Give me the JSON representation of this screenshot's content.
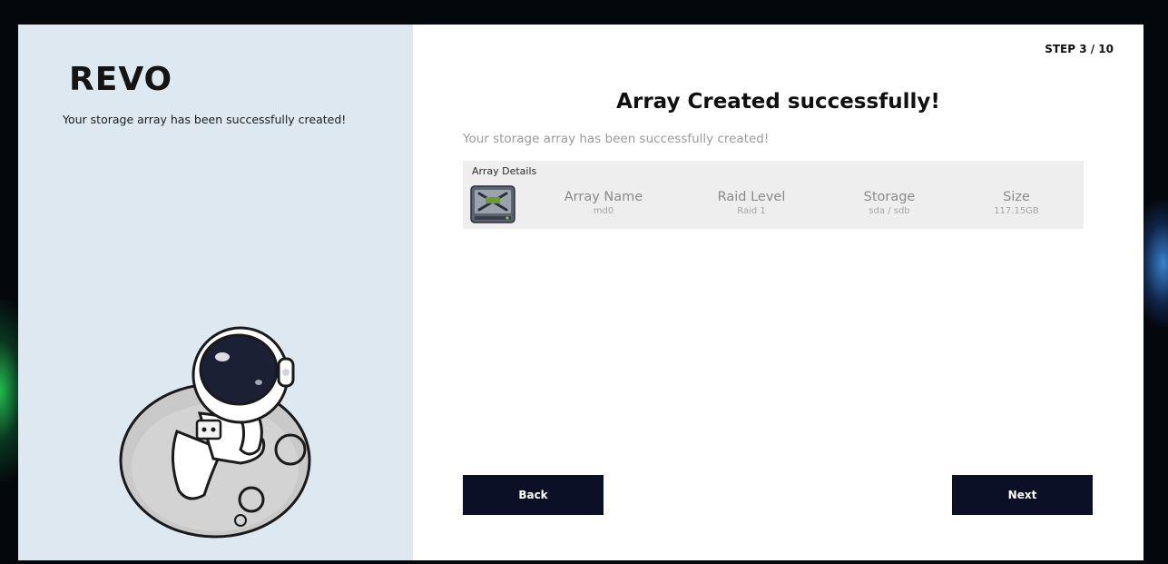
{
  "app": {
    "logo": "REVO"
  },
  "sidebar": {
    "description": "Your storage array has been successfully created!"
  },
  "header": {
    "step": "STEP 3 / 10"
  },
  "main": {
    "title": "Array Created successfully!",
    "subtitle": "Your storage array has been successfully created!",
    "details": {
      "label": "Array Details",
      "columns": [
        {
          "heading": "Array Name",
          "value": "md0"
        },
        {
          "heading": "Raid Level",
          "value": "Raid 1"
        },
        {
          "heading": "Storage",
          "value": "sda / sdb"
        },
        {
          "heading": "Size",
          "value": "117.15GB"
        }
      ],
      "icon": "hard-drive-icon"
    }
  },
  "footer": {
    "back_label": "Back",
    "next_label": "Next"
  },
  "colors": {
    "sidebar_bg": "#dde8f1",
    "button_bg": "#0b1027",
    "details_bg": "#eeeeee"
  }
}
